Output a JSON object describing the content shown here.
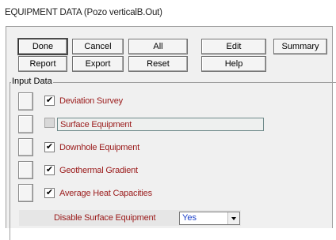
{
  "window": {
    "title": "EQUIPMENT DATA (Pozo verticalB.Out)"
  },
  "toolbar": {
    "done": "Done",
    "cancel": "Cancel",
    "all": "All",
    "edit": "Edit",
    "summary": "Summary",
    "report": "Report",
    "export": "Export",
    "reset": "Reset",
    "help": "Help"
  },
  "input_group": {
    "label": "Input Data",
    "items": [
      {
        "label": "Deviation Survey",
        "checked": true,
        "enabled": true
      },
      {
        "label": "Surface Equipment",
        "checked": false,
        "enabled": false
      },
      {
        "label": "Downhole Equipment",
        "checked": true,
        "enabled": true
      },
      {
        "label": "Geothermal Gradient",
        "checked": true,
        "enabled": true
      },
      {
        "label": "Average Heat Capacities",
        "checked": true,
        "enabled": true
      }
    ]
  },
  "disable_surface": {
    "label": "Disable Surface Equipment",
    "value": "Yes"
  },
  "colors": {
    "label_text": "#9a1a1a",
    "select_value": "#1a3fc8",
    "dialog_bg": "#f0f0f0"
  }
}
